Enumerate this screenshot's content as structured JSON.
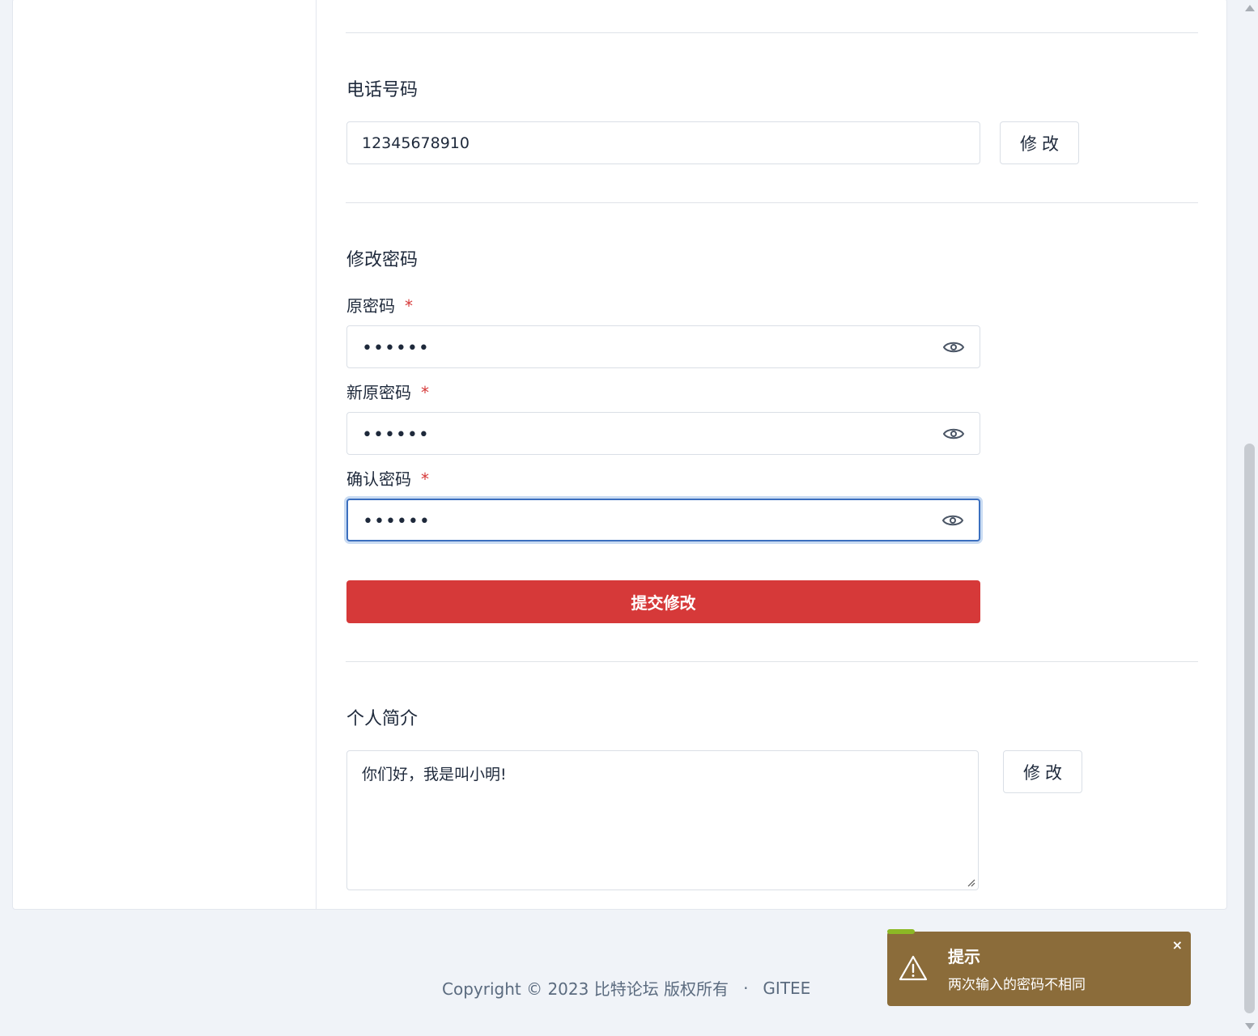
{
  "phone": {
    "title": "电话号码",
    "value": "12345678910",
    "button": "修改"
  },
  "password": {
    "title": "修改密码",
    "old_label": "原密码",
    "new_label": "新原密码",
    "confirm_label": "确认密码",
    "required_mark": "*",
    "old_value": "••••••",
    "new_value": "••••••",
    "confirm_value": "••••••",
    "submit": "提交修改"
  },
  "bio": {
    "title": "个人简介",
    "value": "你们好，我是叫小明!",
    "button": "修改"
  },
  "footer": {
    "copyright": "Copyright © 2023 比特论坛 版权所有",
    "separator": "·",
    "link": "GITEE"
  },
  "toast": {
    "title": "提示",
    "message": "两次输入的密码不相同",
    "close": "×",
    "accent": "#8b6c3a"
  },
  "icons": [
    "eye-icon",
    "warning-icon",
    "close-icon",
    "resize-handle-icon"
  ]
}
